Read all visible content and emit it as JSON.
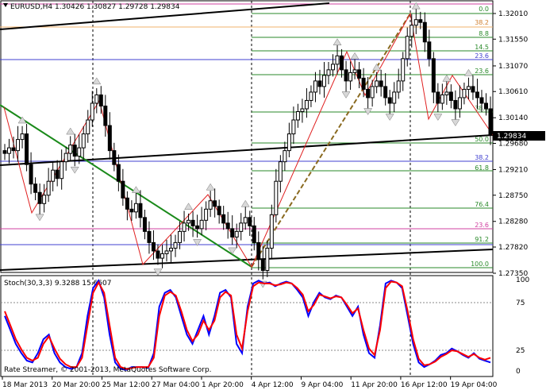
{
  "chart_data": {
    "type": "candlestick",
    "main_title": "EURUSD,H4  1.30426 1.30827 1.29728 1.29834",
    "current_price": "1.29834",
    "y_ticks": [
      "1.32010",
      "1.31550",
      "1.31070",
      "1.30610",
      "1.30140",
      "1.29680",
      "1.29210",
      "1.28750",
      "1.28280",
      "1.27820",
      "1.27350"
    ],
    "x_ticks": [
      "18 Mar 2013",
      "20 Mar 20:00",
      "25 Mar 12:00",
      "27 Mar 04:00",
      "1 Apr 20:00",
      "4 Apr 12:00",
      "9 Apr 04:00",
      "11 Apr 20:00",
      "16 Apr 12:00",
      "19 Apr 04:00"
    ],
    "fibo_top": [
      "0.0",
      "38.2",
      "8.8",
      "14.5",
      "23.6",
      "23.6",
      "38.2"
    ],
    "fibo_bottom": [
      "50.0",
      "38.2",
      "61.8",
      "76.4",
      "23.6",
      "91.2",
      "100.0"
    ],
    "stoch_title": "Stoch(30,3,3) 9.3288 15.6607",
    "stoch_levels": [
      "100",
      "75",
      "25",
      "0"
    ],
    "copyright": "Rate Streamer, © 2001-2013, MetaQuotes Software Corp.",
    "close_series": [
      1.295,
      1.296,
      1.2955,
      1.2975,
      1.2985,
      1.293,
      1.2895,
      1.288,
      1.286,
      1.2875,
      1.29,
      1.292,
      1.2905,
      1.2935,
      1.295,
      1.2965,
      1.2945,
      1.296,
      1.2985,
      1.301,
      1.304,
      1.3055,
      1.3035,
      1.3,
      1.2955,
      1.293,
      1.29,
      1.287,
      1.285,
      1.2845,
      1.286,
      1.2835,
      1.281,
      1.279,
      1.2775,
      1.2762,
      1.277,
      1.2775,
      1.278,
      1.279,
      1.281,
      1.2825,
      1.283,
      1.282,
      1.2815,
      1.283,
      1.285,
      1.2865,
      1.2855,
      1.284,
      1.2825,
      1.2815,
      1.28,
      1.281,
      1.2825,
      1.2835,
      1.282,
      1.279,
      1.276,
      1.274,
      1.278,
      1.284,
      1.29,
      1.2935,
      1.2955,
      1.2985,
      1.301,
      1.3025,
      1.303,
      1.3045,
      1.306,
      1.308,
      1.307,
      1.309,
      1.31,
      1.311,
      1.3125,
      1.31,
      1.308,
      1.3095,
      1.31,
      1.3085,
      1.3065,
      1.305,
      1.307,
      1.308,
      1.307,
      1.305,
      1.304,
      1.306,
      1.308,
      1.312,
      1.316,
      1.318,
      1.319,
      1.3185,
      1.315,
      1.312,
      1.306,
      1.304,
      1.3055,
      1.306,
      1.3045,
      1.303,
      1.305,
      1.3065,
      1.307,
      1.306,
      1.305,
      1.304,
      1.303,
      1.2983
    ],
    "stoch_main": [
      60,
      45,
      30,
      20,
      12,
      10,
      20,
      35,
      40,
      20,
      10,
      5,
      3,
      5,
      20,
      60,
      90,
      98,
      80,
      40,
      10,
      3,
      2,
      5,
      5,
      5,
      4,
      20,
      70,
      85,
      88,
      80,
      60,
      40,
      30,
      45,
      60,
      40,
      60,
      85,
      88,
      80,
      30,
      20,
      70,
      95,
      98,
      95,
      96,
      92,
      95,
      97,
      95,
      88,
      80,
      60,
      75,
      85,
      80,
      78,
      82,
      80,
      70,
      60,
      70,
      40,
      20,
      15,
      50,
      95,
      98,
      96,
      90,
      60,
      30,
      10,
      5,
      8,
      12,
      18,
      20,
      25,
      22,
      18,
      15,
      20,
      14,
      12,
      10
    ],
    "stoch_signal": [
      65,
      50,
      35,
      24,
      15,
      12,
      15,
      30,
      38,
      25,
      14,
      8,
      5,
      5,
      15,
      50,
      85,
      96,
      85,
      50,
      15,
      5,
      3,
      4,
      5,
      5,
      5,
      15,
      60,
      82,
      86,
      82,
      65,
      45,
      33,
      40,
      55,
      45,
      55,
      80,
      86,
      82,
      40,
      25,
      65,
      92,
      96,
      95,
      95,
      93,
      94,
      96,
      95,
      90,
      83,
      65,
      72,
      83,
      81,
      79,
      81,
      80,
      72,
      63,
      68,
      45,
      25,
      18,
      45,
      90,
      97,
      96,
      92,
      65,
      35,
      14,
      7,
      8,
      11,
      16,
      19,
      23,
      22,
      19,
      16,
      19,
      15,
      13,
      15
    ]
  }
}
